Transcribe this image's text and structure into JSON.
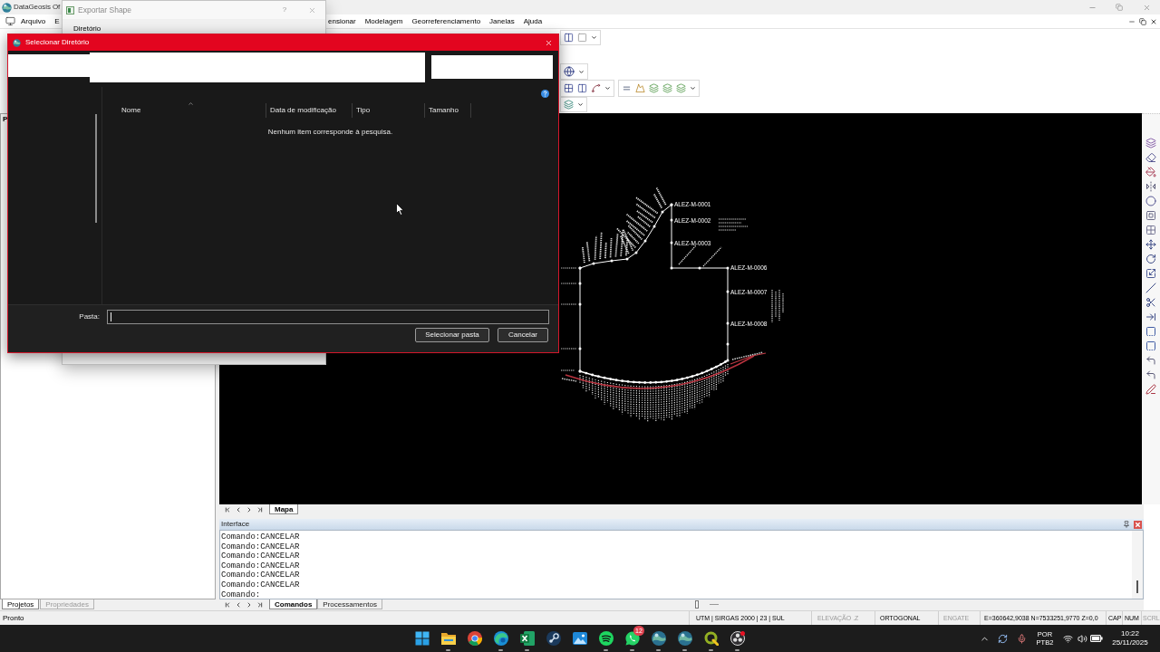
{
  "app": {
    "title": "DataGeosis Of"
  },
  "menu": [
    {
      "label": "Arquivo"
    },
    {
      "label": "E"
    },
    {
      "label": "ensionar"
    },
    {
      "label": "Modelagem"
    },
    {
      "label": "Georreferenciamento"
    },
    {
      "label": "Janelas"
    },
    {
      "label": "Ajuda"
    }
  ],
  "left_panel": {
    "header": "P",
    "tabs": [
      {
        "label": "Projetos",
        "selected": true
      },
      {
        "label": "Propriedades",
        "selected": false
      }
    ]
  },
  "map": {
    "point_labels": [
      "ALEZ-M-0001",
      "ALEZ-M-0002",
      "ALEZ-M-0003",
      "ALEZ-M-0006",
      "ALEZ-M-0007",
      "ALEZ-M-0008"
    ],
    "tabs": [
      {
        "label": "Mapa",
        "selected": true
      }
    ]
  },
  "interface_panel": {
    "title": "Interface",
    "lines": [
      "Comando:CANCELAR",
      "Comando:CANCELAR",
      "Comando:CANCELAR",
      "Comando:CANCELAR",
      "Comando:CANCELAR",
      "Comando:CANCELAR",
      "Comando:"
    ],
    "tabs": [
      {
        "label": "Comandos",
        "selected": true
      },
      {
        "label": "Processamentos",
        "selected": false
      }
    ]
  },
  "status_bar": {
    "message": "Pronto",
    "items": [
      {
        "text": "UTM | SIRGAS 2000 | 23 | SUL",
        "active": true
      },
      {
        "text": "ELEVAÇÃO .Z",
        "active": false
      },
      {
        "text": "ORTOGONAL",
        "active": true
      },
      {
        "text": "ENGATE",
        "active": false
      },
      {
        "text": "E=360642,9038 N=7533251,9770 Z=0,0",
        "active": true
      },
      {
        "text": "CAP",
        "active": true
      },
      {
        "text": "NUM",
        "active": true
      },
      {
        "text": "SCRL",
        "active": false
      }
    ]
  },
  "taskbar": {
    "apps": [
      {
        "kind": "start",
        "running": false
      },
      {
        "kind": "folder",
        "running": true
      },
      {
        "kind": "chrome",
        "running": false
      },
      {
        "kind": "edge",
        "running": true
      },
      {
        "kind": "excel",
        "running": true
      },
      {
        "kind": "steam",
        "running": false
      },
      {
        "kind": "photos",
        "running": false
      },
      {
        "kind": "spotify",
        "running": true
      },
      {
        "kind": "whatsapp",
        "running": true,
        "badge": "12"
      },
      {
        "kind": "globe",
        "running": true
      },
      {
        "kind": "globe",
        "running": true
      },
      {
        "kind": "qgis",
        "running": true
      },
      {
        "kind": "obs",
        "running": true
      }
    ],
    "language": "POR",
    "layout": "PTB2",
    "time": "10:22",
    "date": "25/11/2025"
  },
  "export_dialog": {
    "title": "Exportar Shape",
    "help": "?",
    "field_label": "Diretório"
  },
  "folder_dialog": {
    "title": "Selecionar Diretório",
    "columns": [
      {
        "label": "Nome",
        "sorted": true
      },
      {
        "label": "Data de modificação",
        "sorted": false
      },
      {
        "label": "Tipo",
        "sorted": false
      },
      {
        "label": "Tamanho",
        "sorted": false
      }
    ],
    "empty_message": "Nenhum item corresponde à pesquisa.",
    "folder_label": "Pasta:",
    "folder_focused": true,
    "buttons": [
      {
        "label": "Selecionar pasta"
      },
      {
        "label": "Cancelar"
      }
    ]
  }
}
